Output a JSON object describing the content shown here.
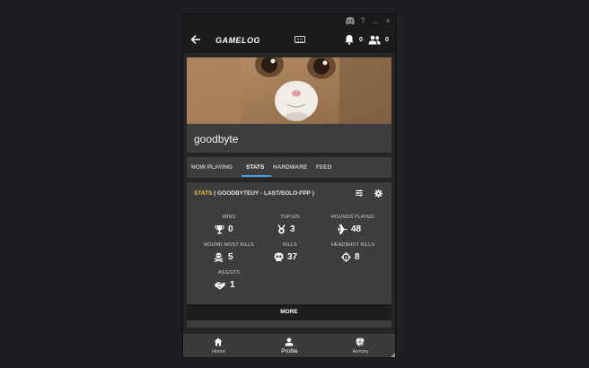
{
  "titlebar": {
    "icons": [
      "discord-icon",
      "help-icon",
      "minimize-icon",
      "close-icon"
    ],
    "help_label": "?",
    "minimize_label": "_",
    "close_label": "×"
  },
  "appbar": {
    "logo": "GAMELOG",
    "notifications_count": "0",
    "friends_count": "0"
  },
  "profile": {
    "name": "goodbyte"
  },
  "tabs": [
    {
      "label": "NOW PLAYING"
    },
    {
      "label": "STATS"
    },
    {
      "label": "HARDWARE"
    },
    {
      "label": "FEED"
    }
  ],
  "stats": {
    "heading_label": "STATS",
    "heading_detail": " ( GOODBYTEUY - LAST/SOLO-FPP )",
    "items": [
      {
        "label": "WINS",
        "value": "0",
        "icon": "trophy-icon"
      },
      {
        "label": "TOP10S",
        "value": "3",
        "icon": "medal-icon"
      },
      {
        "label": "ROUNDS PLAYED",
        "value": "48",
        "icon": "plane-icon"
      },
      {
        "label": "ROUND MOST KILLS",
        "value": "5",
        "icon": "skull-crossbones-icon"
      },
      {
        "label": "KILLS",
        "value": "37",
        "icon": "skull-icon"
      },
      {
        "label": "HEADSHOT KILLS",
        "value": "8",
        "icon": "crosshair-icon"
      },
      {
        "label": "ASSISTS",
        "value": "1",
        "icon": "handshake-icon"
      }
    ],
    "more_label": "MORE"
  },
  "bottom_nav": [
    {
      "label": "Home",
      "icon": "home-icon"
    },
    {
      "label": "Profile",
      "icon": "person-icon"
    },
    {
      "label": "Armory",
      "icon": "shield-icon"
    }
  ],
  "colors": {
    "accent_yellow": "#f3c33d",
    "tab_underline": "#48a0e0"
  }
}
